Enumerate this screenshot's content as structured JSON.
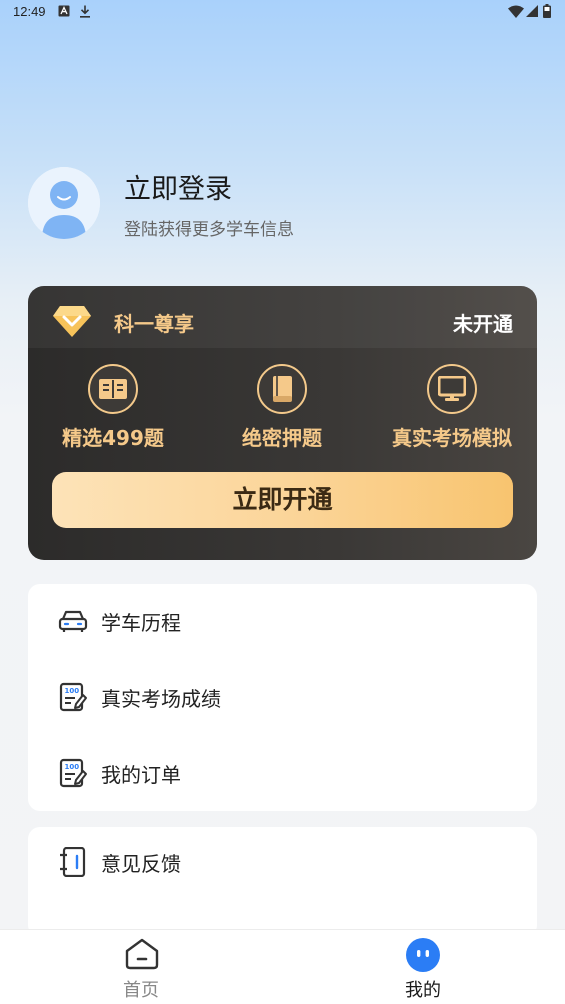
{
  "status_bar": {
    "time": "12:49",
    "left_icons": [
      "a-icon",
      "download-icon"
    ],
    "right_icons": [
      "wifi-icon",
      "signal-icon",
      "battery-icon"
    ]
  },
  "profile": {
    "title": "立即登录",
    "subtitle": "登陆获得更多学车信息",
    "avatar_icon": "user-avatar-icon"
  },
  "vip": {
    "name": "科一尊享",
    "status": "未开通",
    "perks": [
      {
        "label": "精选499题",
        "icon": "book-open-icon"
      },
      {
        "label": "绝密押题",
        "icon": "book-icon"
      },
      {
        "label": "真实考场模拟",
        "icon": "monitor-icon"
      }
    ],
    "button": "立即开通",
    "colors": {
      "gold": "#f5c98a",
      "card_dark": "#2c2b2a"
    }
  },
  "menu_group_1": [
    {
      "label": "学车历程",
      "icon": "car-icon"
    },
    {
      "label": "真实考场成绩",
      "icon": "score-report-icon"
    },
    {
      "label": "我的订单",
      "icon": "order-icon"
    }
  ],
  "menu_group_2": [
    {
      "label": "意见反馈",
      "icon": "feedback-notebook-icon"
    }
  ],
  "tab_bar": {
    "tabs": [
      {
        "label": "首页",
        "icon": "home-icon",
        "active": false
      },
      {
        "label": "我的",
        "icon": "mine-face-icon",
        "active": true
      }
    ],
    "active_color": "#2b7df5"
  }
}
